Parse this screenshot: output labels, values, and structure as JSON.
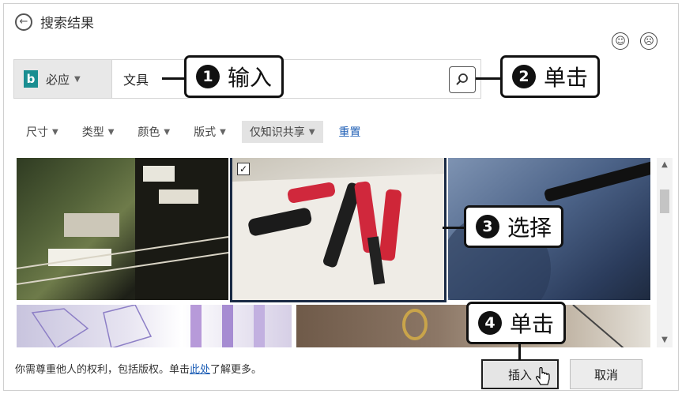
{
  "header": {
    "title": "搜索结果"
  },
  "search": {
    "provider": "必应",
    "query": "文具"
  },
  "filters": [
    "尺寸",
    "类型",
    "颜色",
    "版式",
    "仅知识共享"
  ],
  "reset_label": "重置",
  "callouts": [
    {
      "num": "1",
      "text": "输入"
    },
    {
      "num": "2",
      "text": "单击"
    },
    {
      "num": "3",
      "text": "选择"
    },
    {
      "num": "4",
      "text": "单击"
    }
  ],
  "footer": {
    "before": "你需尊重他人的权利，包括版权。单击",
    "link": "此处",
    "after": "了解更多。"
  },
  "buttons": {
    "insert": "插入",
    "cancel": "取消"
  },
  "colors": {
    "accent_link": "#1f5fb6",
    "bing_logo": "#1a8e91"
  },
  "icons": [
    "back-arrow-icon",
    "smile-icon",
    "frown-icon",
    "bing-logo-icon",
    "search-icon",
    "checkmark-icon",
    "hand-cursor-icon"
  ]
}
